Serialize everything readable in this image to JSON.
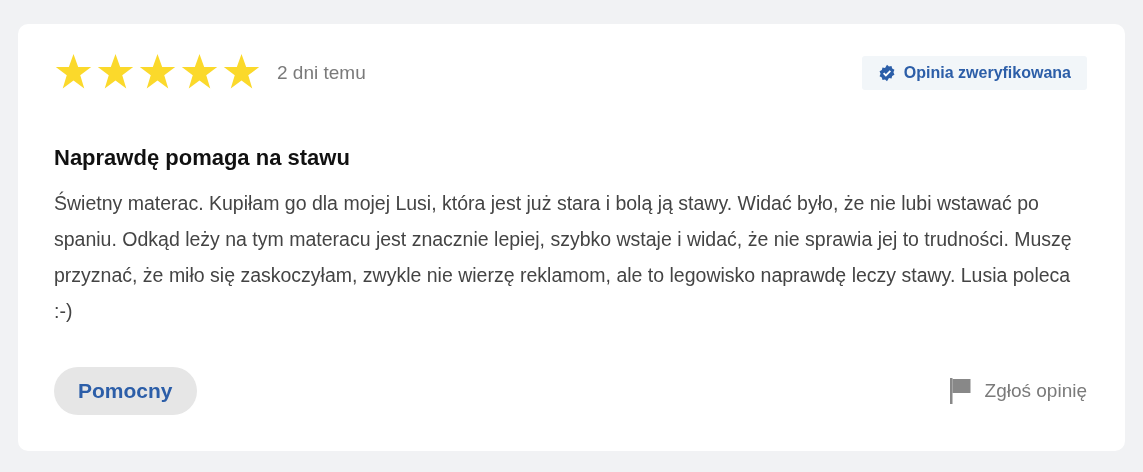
{
  "review": {
    "stars": 5,
    "date": "2 dni temu",
    "verified": true,
    "badge": "Opinia zweryfikowana",
    "title": "Naprawdę pomaga na stawu",
    "body": "Świetny materac. Kupiłam go dla mojej Lusi, która jest już stara i bolą ją stawy. Widać było, że nie lubi wstawać po spaniu. Odkąd leży na tym materacu jest znacznie lepiej, szybko wstaje i widać, że nie sprawia jej to trudności. Muszę przyznać, że miło się zaskoczyłam, zwykle nie wierzę reklamom, ale to legowisko naprawdę leczy stawy. Lusia poleca :-)",
    "helpful_button": "Pomocny",
    "report_link": "Zgłoś opinię"
  }
}
